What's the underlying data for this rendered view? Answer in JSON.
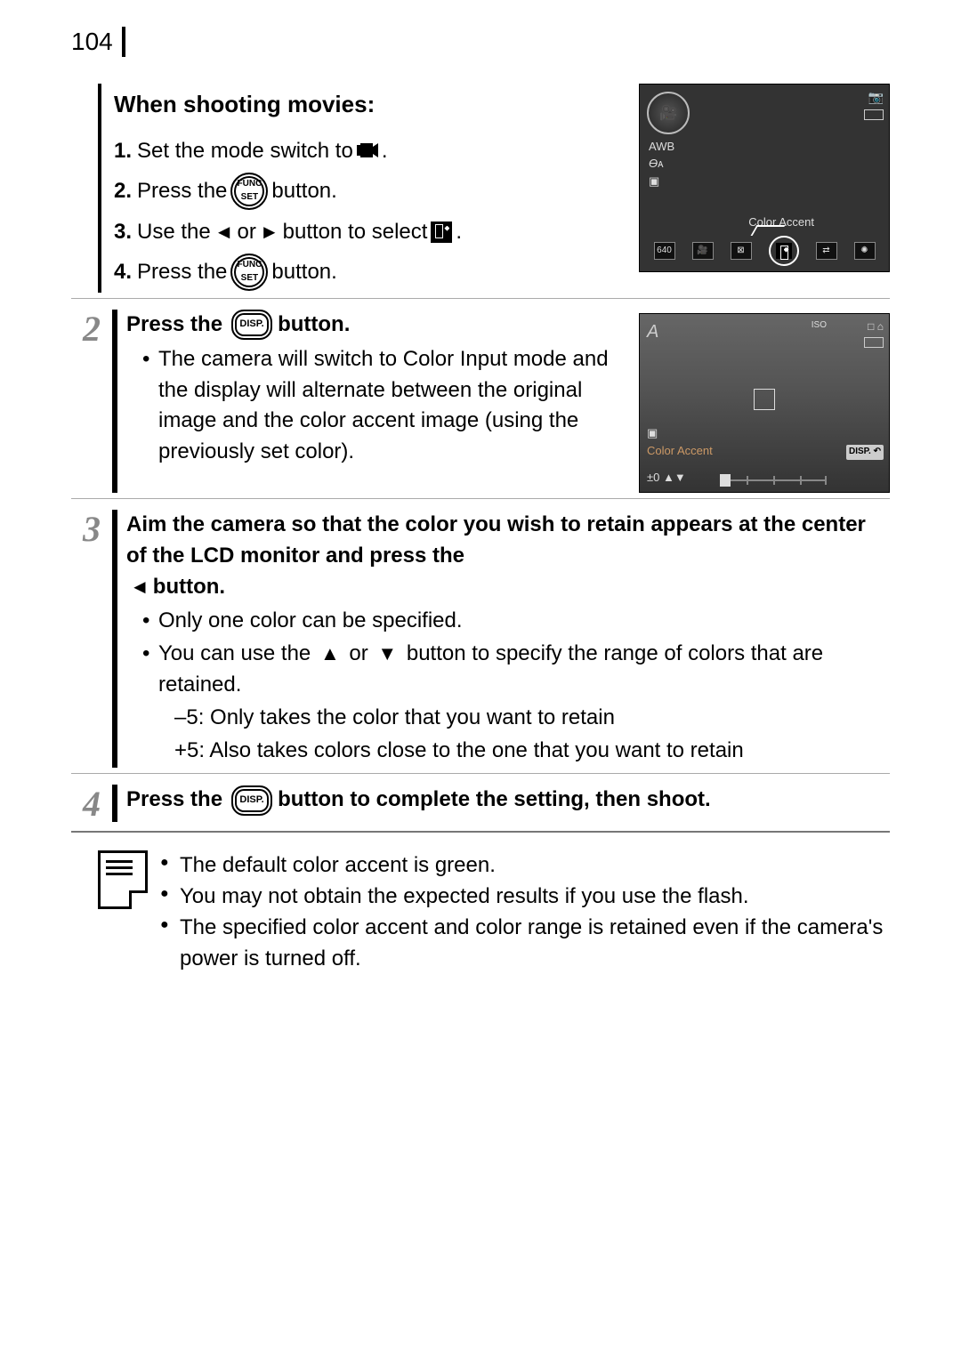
{
  "page_number": "104",
  "section1": {
    "heading": "When shooting movies:",
    "items": [
      {
        "n": "1.",
        "before": "Set the mode switch to ",
        "after": "."
      },
      {
        "n": "2.",
        "before": "Press the ",
        "after": " button."
      },
      {
        "n": "3.",
        "before": "Use the ",
        "mid": " or ",
        "mid2": " button to select ",
        "after": "."
      },
      {
        "n": "4.",
        "before": "Press the ",
        "after": " button."
      }
    ]
  },
  "screen1": {
    "mode_label": "A",
    "awb": "AWB",
    "label": "Color Accent",
    "res": "640"
  },
  "step2": {
    "num": "2",
    "title_before": "Press the ",
    "title_after": " button.",
    "bullet": "The camera will switch to Color Input mode and the display will alternate between the original image and the color accent image (using the previously set color)."
  },
  "screen2": {
    "tl": "A",
    "iso": "ISO",
    "label": "Color Accent",
    "disp": "DISP.",
    "bl": "±0",
    "tr_icons": "□ ⌂"
  },
  "step3": {
    "num": "3",
    "title_before": "Aim the camera so that the color you wish to retain appears at the center of the LCD monitor and press the ",
    "title_after": " button.",
    "b1": "Only one color can be specified.",
    "b2_before": "You can use the ",
    "b2_mid": " or ",
    "b2_after": " button to specify the range of colors that are retained.",
    "r1": "–5:  Only takes the color that you want to retain",
    "r2": "+5:  Also takes colors close to the one that you want to retain"
  },
  "step4": {
    "num": "4",
    "title_before": "Press the ",
    "title_after": " button to complete the setting, then shoot."
  },
  "notes": {
    "n1": "The default color accent is green.",
    "n2": "You may not obtain the expected results if you use the flash.",
    "n3": "The specified color accent and color range is retained even if the camera's power is turned off."
  },
  "icons": {
    "left": "◄",
    "right": "►",
    "up": "▲",
    "down": "▼"
  }
}
